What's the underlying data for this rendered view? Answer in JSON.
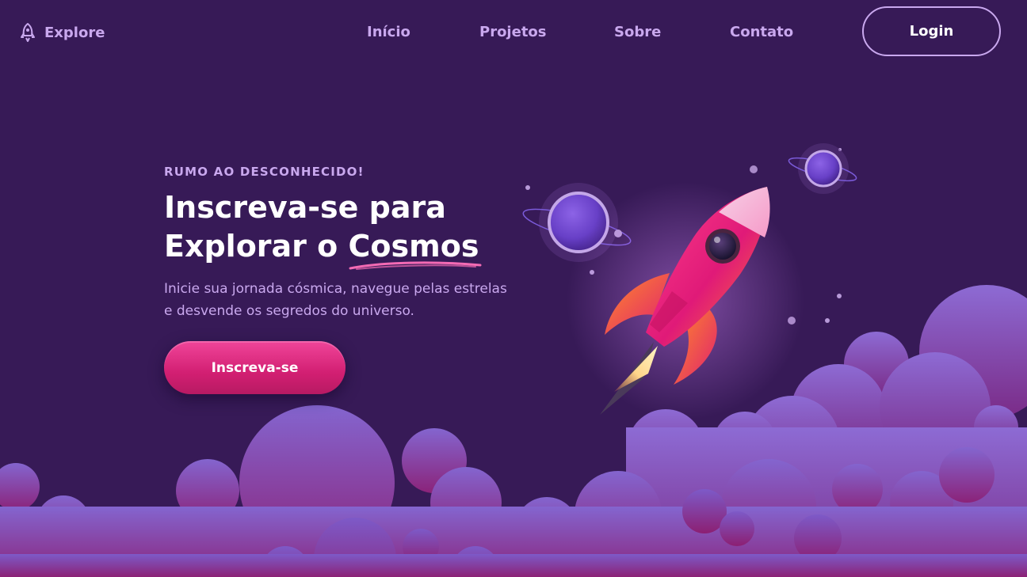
{
  "header": {
    "logo_icon": "rocket-icon",
    "logo_text": "Explore",
    "nav": [
      "Início",
      "Projetos",
      "Sobre",
      "Contato"
    ],
    "login_label": "Login"
  },
  "hero": {
    "eyebrow": "RUMO AO DESCONHECIDO!",
    "headline_line1": "Inscreva-se para",
    "headline_line2_prefix": "Explorar o ",
    "headline_highlight": "Cosmos",
    "subtitle": "Inicie sua jornada cósmica, navegue pelas estrelas e desvende os segredos do universo.",
    "cta_label": "Inscreva-se"
  },
  "colors": {
    "background": "#371a57",
    "accent_text": "#c9a8ee",
    "cta_pink": "#e0287f",
    "cloud_top": "#8c6fd6",
    "cloud_bottom": "#8a1f7a"
  }
}
